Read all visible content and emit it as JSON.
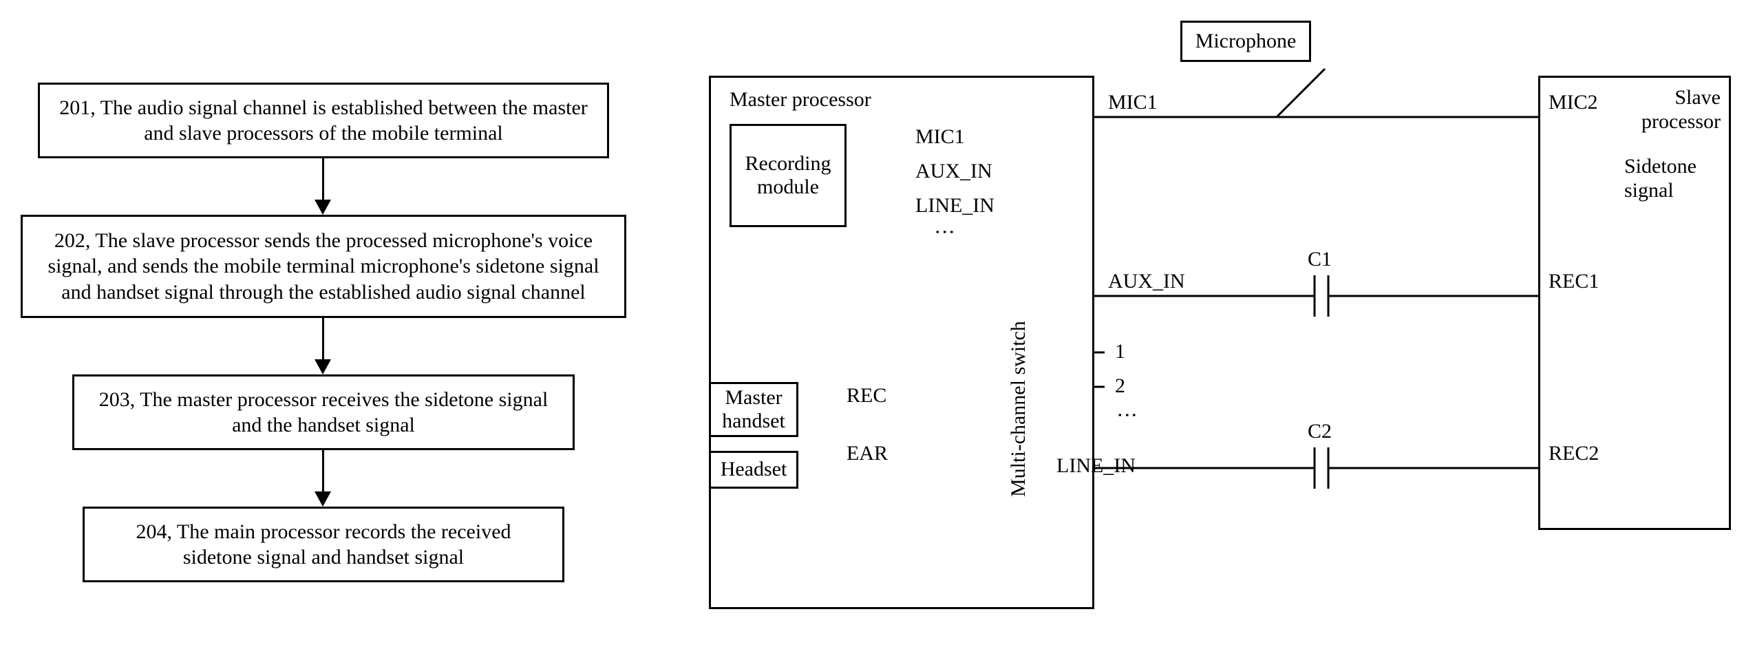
{
  "flow": {
    "step1": "201, The audio signal channel is established between the master and slave processors of the mobile terminal",
    "step2": "202, The slave processor sends the processed microphone's voice signal, and sends the mobile terminal microphone's sidetone signal and handset signal through the established audio signal channel",
    "step3": "203, The master processor receives the sidetone signal and the handset signal",
    "step4": "204, The main processor records the received sidetone signal and handset signal"
  },
  "schematic": {
    "microphone": "Microphone",
    "master_proc": "Master processor",
    "slave_proc": "Slave processor",
    "recording_module": "Recording module",
    "multi_switch": "Multi-channel switch",
    "master_handset": "Master handset",
    "headset": "Headset",
    "mic1": "MIC1",
    "mic2": "MIC2",
    "aux_in_rec": "AUX_IN",
    "line_in_rec": "LINE_IN",
    "aux_in_bus": "AUX_IN",
    "line_in_bus": "LINE_IN",
    "rec": "REC",
    "ear": "EAR",
    "c1": "C1",
    "c2": "C2",
    "rec1": "REC1",
    "rec2": "REC2",
    "sidetone": "Sidetone signal",
    "sw1": "1",
    "sw2": "2"
  }
}
